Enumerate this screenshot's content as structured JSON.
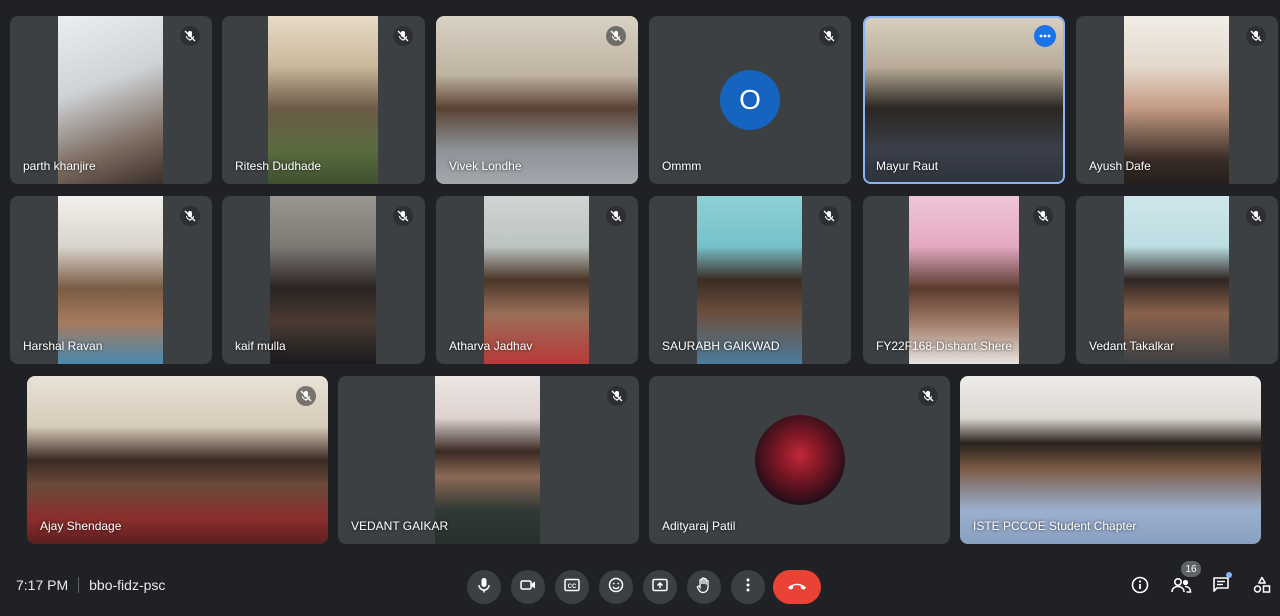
{
  "participants": [
    {
      "name": "parth khanjire",
      "muted": true
    },
    {
      "name": "Ritesh Dudhade",
      "muted": true
    },
    {
      "name": "Vivek Londhe",
      "muted": true
    },
    {
      "name": "Ommm",
      "muted": true,
      "avatar_letter": "O"
    },
    {
      "name": "Mayur Raut",
      "active_speaker": true
    },
    {
      "name": "Ayush Dafe",
      "muted": true
    },
    {
      "name": "Harshal Ravan",
      "muted": true
    },
    {
      "name": "kaif mulla",
      "muted": true
    },
    {
      "name": "Atharva Jadhav",
      "muted": true
    },
    {
      "name": "SAURABH GAIKWAD",
      "muted": true
    },
    {
      "name": "FY22F168-Dishant Shere",
      "muted": true
    },
    {
      "name": "Vedant Takalkar",
      "muted": true
    },
    {
      "name": "Ajay Shendage",
      "muted": true
    },
    {
      "name": "VEDANT GAIKAR",
      "muted": true
    },
    {
      "name": "Adityaraj Patil",
      "muted": true
    },
    {
      "name": "ISTE PCCOE Student Chapter",
      "muted": false
    }
  ],
  "meeting": {
    "time": "7:17 PM",
    "code": "bbo-fidz-psc",
    "participant_count": "16"
  },
  "controls": [
    "mic-icon",
    "camera-icon",
    "captions-icon",
    "emoji-icon",
    "present-icon",
    "raise-hand-icon",
    "more-options-icon",
    "end-call-icon"
  ],
  "right_controls": [
    "info-icon",
    "people-icon",
    "chat-icon",
    "activities-icon"
  ],
  "colors": {
    "background": "#202124",
    "tile": "#3c4043",
    "accent": "#1a73e8",
    "end_call": "#ea4335"
  }
}
